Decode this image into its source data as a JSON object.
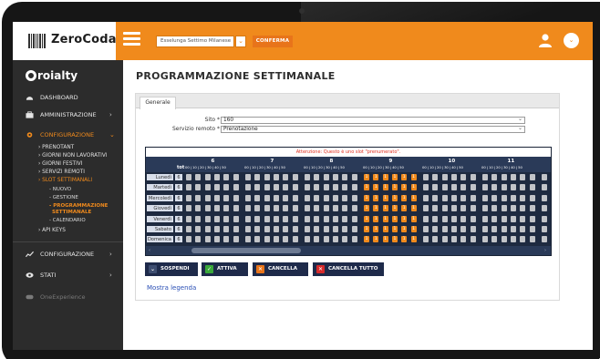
{
  "app": {
    "logo_text": "ZeroCoda",
    "brand": "roialty"
  },
  "topbar": {
    "store_select": "Esselunga Settimo Milanese",
    "confirm_label": "CONFERMA"
  },
  "sidebar": {
    "items": [
      {
        "label": "DASHBOARD",
        "icon": "dashboard-icon"
      },
      {
        "label": "AMMINISTRAZIONE",
        "icon": "briefcase-icon"
      },
      {
        "label": "CONFIGURAZIONE",
        "icon": "gear-icon"
      },
      {
        "label": "CONFIGURAZIONE",
        "icon": "chart-line-icon"
      },
      {
        "label": "STATI",
        "icon": "eye-icon"
      },
      {
        "label": "OneExperience",
        "icon": "gamepad-icon"
      }
    ],
    "config_sub": [
      "PRENOTANT",
      "GIORNI NON LAVORATIVI",
      "GIORNI FESTIVI",
      "SERVIZI REMOTI",
      "SLOT SETTIMANALI"
    ],
    "slot_sub": [
      "NUOVO",
      "GESTIONE",
      "PROGRAMMAZIONE",
      "SETTIMANALE",
      "CALENDARIO"
    ],
    "api_keys": "API KEYS"
  },
  "main": {
    "title": "PROGRAMMAZIONE SETTIMANALE",
    "tab": "Generale",
    "site_label": "Sito *",
    "site_value": "160",
    "service_label": "Servizio remoto *",
    "service_value": "Prenotazione"
  },
  "grid": {
    "warning": "Attenzione: Questo è uno slot \"prenumerato\".",
    "tot_label": "tot",
    "minutes": "00 | 10 | 20 | 30 | 40 | 50",
    "hours": [
      "6",
      "7",
      "8",
      "9",
      "10",
      "11"
    ],
    "days": [
      {
        "name": "Lunedì",
        "tot": "6"
      },
      {
        "name": "Martedì",
        "tot": "6"
      },
      {
        "name": "Mercoledì",
        "tot": "6"
      },
      {
        "name": "Giovedì",
        "tot": "6"
      },
      {
        "name": "Venerdì",
        "tot": "6"
      },
      {
        "name": "Sabato",
        "tot": "6"
      },
      {
        "name": "Domenica",
        "tot": "6"
      }
    ],
    "active_hour": "9",
    "active_value": "1",
    "colors": {
      "active": "#f08a1c",
      "inactive": "#c2c4c8",
      "header": "#2a3a58"
    }
  },
  "actions": {
    "sospendi": "SOSPENDI",
    "attiva": "ATTIVA",
    "cancella": "CANCELLA",
    "cancella_tutto": "CANCELLA TUTTO",
    "legend_link": "Mostra legenda"
  },
  "colors": {
    "accent": "#f08a1c",
    "sidebar_bg": "#2c2c2c",
    "attiva": "#3aa83a",
    "cancella": "#e8741a",
    "cancella_tutto": "#d62a2a"
  }
}
